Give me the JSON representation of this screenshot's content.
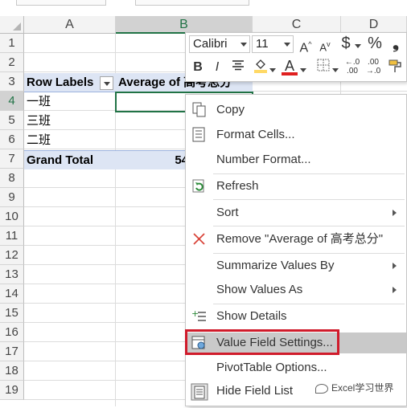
{
  "columns": [
    "A",
    "B",
    "C",
    "D"
  ],
  "rows": [
    "1",
    "2",
    "3",
    "4",
    "5",
    "6",
    "7",
    "8",
    "9",
    "10",
    "11",
    "12",
    "13",
    "14",
    "15",
    "16",
    "17",
    "18",
    "19"
  ],
  "pivot": {
    "row_labels_header": "Row Labels",
    "value_header": "Average of 高考总分",
    "items": [
      "一班",
      "三班",
      "二班"
    ],
    "grand_total_label": "Grand Total",
    "grand_total_value": "54"
  },
  "mini_toolbar": {
    "font_name": "Calibri",
    "font_size": "11",
    "grow_font": "A",
    "shrink_font": "A",
    "currency": "$",
    "percent": "%",
    "comma": "❟",
    "bold": "B",
    "italic": "I",
    "font_color_letter": "A",
    "icons": [
      "increase-font-icon",
      "decrease-font-icon",
      "currency-icon",
      "percent-icon",
      "comma-style-icon",
      "bold-icon",
      "italic-icon",
      "align-center-icon",
      "fill-color-icon",
      "font-color-icon",
      "borders-icon",
      "increase-decimal-icon",
      "decrease-decimal-icon",
      "format-painter-icon"
    ],
    "colors": {
      "fill": "#ffd966",
      "font": "#e02020"
    }
  },
  "menu": {
    "copy": "Copy",
    "format_cells": "Format Cells...",
    "number_format": "Number Format...",
    "refresh": "Refresh",
    "sort": "Sort",
    "remove": "Remove \"Average of 高考总分\"",
    "summarize": "Summarize Values By",
    "show_values_as": "Show Values As",
    "show_details": "Show Details",
    "value_field_settings": "Value Field Settings...",
    "pivot_options": "PivotTable Options...",
    "hide_field_list": "Hide Field List"
  },
  "watermark": "Excel学习世界",
  "colors": {
    "accent": "#217346",
    "highlight_box": "#d01b2b",
    "pivot_fill": "#dde5f4"
  }
}
